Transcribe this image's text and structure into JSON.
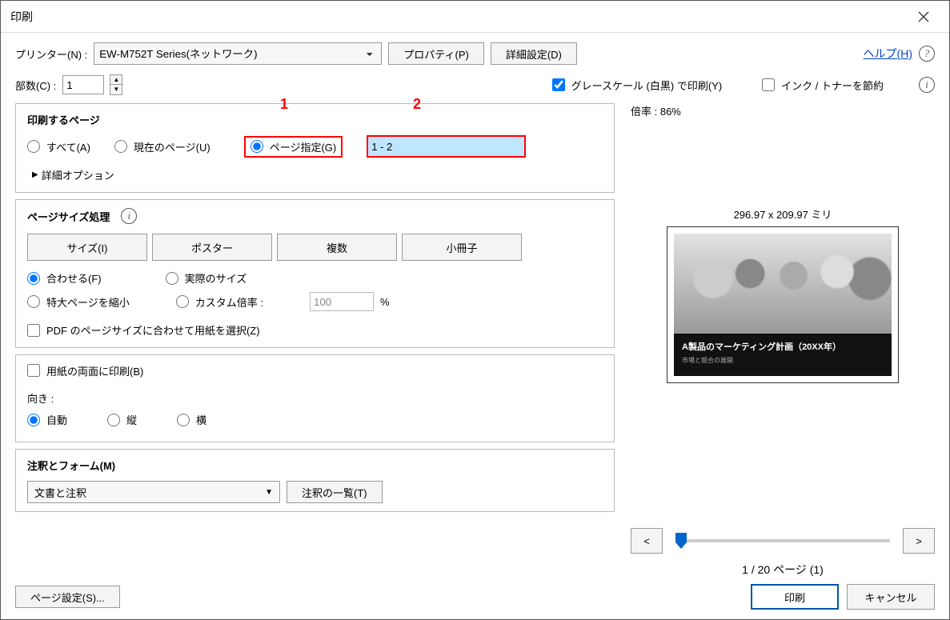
{
  "window": {
    "title": "印刷"
  },
  "top": {
    "printer_label": "プリンター(N) :",
    "printer_value": "EW-M752T Series(ネットワーク)",
    "properties_btn": "プロパティ(P)",
    "advanced_btn": "詳細設定(D)",
    "help_link": "ヘルプ(H)"
  },
  "copies": {
    "label": "部数(C) :",
    "value": "1",
    "grayscale_label": "グレースケール (白黒) で印刷(Y)",
    "savetoner_label": "インク / トナーを節約"
  },
  "pages": {
    "title": "印刷するページ",
    "all": "すべて(A)",
    "current": "現在のページ(U)",
    "range": "ページ指定(G)",
    "range_value": "1 - 2",
    "more": "詳細オプション",
    "annot1": "1",
    "annot2": "2"
  },
  "sizing": {
    "title": "ページサイズ処理",
    "size_btn": "サイズ(I)",
    "poster_btn": "ポスター",
    "multi_btn": "複数",
    "booklet_btn": "小冊子",
    "fit": "合わせる(F)",
    "actual": "実際のサイズ",
    "shrink": "特大ページを縮小",
    "custom": "カスタム倍率 :",
    "custom_value": "100",
    "percent": "%",
    "pdfsize": "PDF のページサイズに合わせて用紙を選択(Z)"
  },
  "duplex": {
    "label": "用紙の両面に印刷(B)"
  },
  "orient": {
    "label": "向き :",
    "auto": "自動",
    "portrait": "縦",
    "landscape": "横"
  },
  "comments": {
    "title": "注釈とフォーム(M)",
    "value": "文書と注釈",
    "btn": "注釈の一覧(T)"
  },
  "preview": {
    "scale_label": "倍率 : 86%",
    "dims": "296.97 x 209.97 ミリ",
    "caption_title": "A製品のマーケティング計画（20XX年）",
    "caption_sub": "市場と競合の展開",
    "page_ind": "1 / 20 ページ (1)",
    "prev": "<",
    "next": ">"
  },
  "bottom": {
    "pagesetup": "ページ設定(S)...",
    "print": "印刷",
    "cancel": "キャンセル"
  }
}
